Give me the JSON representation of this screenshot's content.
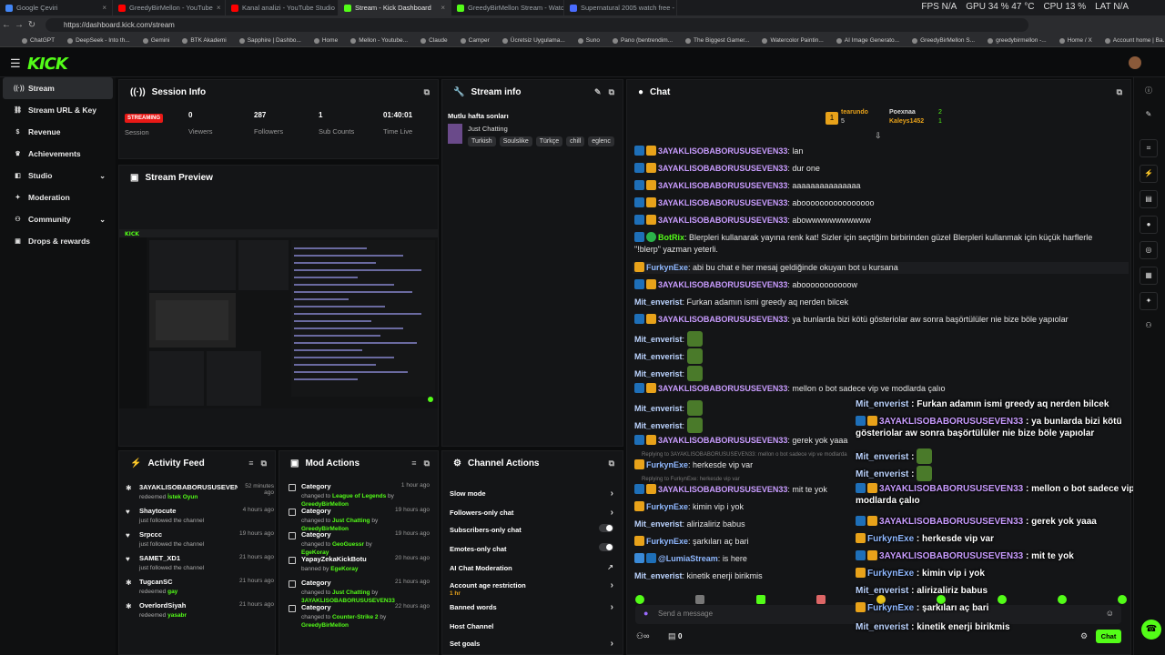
{
  "browser": {
    "tabs": [
      "Google Çeviri",
      "GreedyBirMellon - YouTube",
      "Kanal analizi - YouTube Studio",
      "Stream - Kick Dashboard",
      "GreedyBirMellon Stream - Watch",
      "Supernatural 2005 watch free - 1s"
    ],
    "url": "https://dashboard.kick.com/stream",
    "perf": [
      "FPS N/A",
      "GPU 34 % 47 °C",
      "CPU 13 %",
      "LAT N/A"
    ],
    "bookmarks": [
      "ChatGPT",
      "DeepSeek - Into th...",
      "Gemini",
      "BTK Akademi",
      "Sapphire | Dashbo...",
      "Home",
      "Mellon - Youtube...",
      "Claude",
      "Camper",
      "Ücretsiz Uygulama...",
      "Suno",
      "Pano (bentrendim...",
      "The Biggest Gamer...",
      "Watercolor Paintin...",
      "AI Image Generato...",
      "GreedyBirMellon S...",
      "greedybirmellon -...",
      "Home / X",
      "Account home | Ba..."
    ]
  },
  "app": {
    "logo": "KICK"
  },
  "sidebar": [
    {
      "label": "Stream",
      "icon": "broadcast-icon"
    },
    {
      "label": "Stream URL & Key",
      "icon": "link-icon"
    },
    {
      "label": "Revenue",
      "icon": "dollar-icon"
    },
    {
      "label": "Achievements",
      "icon": "trophy-icon"
    },
    {
      "label": "Studio",
      "icon": "studio-icon"
    },
    {
      "label": "Moderation",
      "icon": "wrench-icon"
    },
    {
      "label": "Community",
      "icon": "people-icon"
    },
    {
      "label": "Drops & rewards",
      "icon": "gift-icon"
    }
  ],
  "session": {
    "title": "Session Info",
    "status": "STREAMING",
    "session_label": "Session",
    "stats": [
      {
        "value": "0",
        "label": "Viewers"
      },
      {
        "value": "287",
        "label": "Followers"
      },
      {
        "value": "1",
        "label": "Sub Counts"
      },
      {
        "value": "01:40:01",
        "label": "Time Live"
      }
    ]
  },
  "preview": {
    "title": "Stream Preview"
  },
  "streaminfo": {
    "title": "Stream info",
    "stream_title": "Mutlu hafta sonları",
    "category": "Just Chatting",
    "tags": [
      "Turkish",
      "Soulslike",
      "Türkçe",
      "chill",
      "eglenc"
    ]
  },
  "chat": {
    "title": "Chat",
    "top": {
      "sub": "tearundo",
      "sub_count": "5",
      "leader1": "Poexnaa",
      "leader1_count": "2",
      "leader2": "Kaleys1452",
      "leader2_count": "1"
    },
    "messages": [
      {
        "user": "3AYAKLISOBABORUSUSEVEN33",
        "text": "lan",
        "color": "#c99cff"
      },
      {
        "user": "3AYAKLISOBABORUSUSEVEN33",
        "text": "dur one",
        "color": "#c99cff"
      },
      {
        "user": "3AYAKLISOBABORUSUSEVEN33",
        "text": "aaaaaaaaaaaaaaa",
        "color": "#c99cff"
      },
      {
        "user": "3AYAKLISOBABORUSUSEVEN33",
        "text": "aboooooooooooooooo",
        "color": "#c99cff"
      },
      {
        "user": "3AYAKLISOBABORUSUSEVEN33",
        "text": "abowwwwwwwwwww",
        "color": "#c99cff"
      },
      {
        "user": "BotRix",
        "text": "Blerpleri kullanarak yayına renk kat! Sizler için seçtiğim birbirinden güzel Blerpleri kullanmak için küçük harflerle \"!blerp\" yazman yeterli.",
        "color": "#53fc18"
      },
      {
        "user": "FurkynExe",
        "text": "abi bu chat e her mesaj geldiğinde okuyan bot u kursana",
        "color": "#8fb8ff"
      },
      {
        "user": "3AYAKLISOBABORUSUSEVEN33",
        "text": "abooooooooooow",
        "color": "#c99cff"
      },
      {
        "user": "Mit_enverist",
        "text": "Furkan adamın ismi greedy aq nerden bilcek",
        "color": "#bcd4ff"
      },
      {
        "user": "3AYAKLISOBABORUSUSEVEN33",
        "text": "ya bunlarda bizi kötü gösteriolar aw sonra başörtülüler nie bize böle yapıolar",
        "color": "#c99cff"
      },
      {
        "user": "Mit_enverist",
        "text": "",
        "color": "#bcd4ff"
      },
      {
        "user": "Mit_enverist",
        "text": "",
        "color": "#bcd4ff"
      },
      {
        "user": "Mit_enverist",
        "text": "",
        "color": "#bcd4ff"
      },
      {
        "user": "3AYAKLISOBABORUSUSEVEN33",
        "text": "mellon o bot sadece vip ve modlarda çalıo",
        "color": "#c99cff"
      },
      {
        "user": "Mit_enverist",
        "text": "",
        "color": "#bcd4ff"
      },
      {
        "user": "Mit_enverist",
        "text": "",
        "color": "#bcd4ff"
      },
      {
        "user": "3AYAKLISOBABORUSUSEVEN33",
        "text": "gerek yok yaaa",
        "color": "#c99cff"
      },
      {
        "user": "FurkynExe",
        "text": "herkesde vip var",
        "color": "#8fb8ff",
        "reply": "Replying to 3AYAKLISOBABORUSUSEVEN33: mellon o bot sadece vip ve modlarda"
      },
      {
        "user": "3AYAKLISOBABORUSUSEVEN33",
        "text": "mit te yok",
        "color": "#c99cff",
        "reply": "Replying to FurkynExe: herkesde vip var"
      },
      {
        "user": "FurkynExe",
        "text": "kimin vip i yok",
        "color": "#8fb8ff"
      },
      {
        "user": "Mit_enverist",
        "text": "alirizaliriz babus",
        "color": "#bcd4ff"
      },
      {
        "user": "FurkynExe",
        "text": "şarkıları aç bari",
        "color": "#8fb8ff"
      },
      {
        "user": "@LumiaStream",
        "text": "is here",
        "color": "#8fb8ff"
      },
      {
        "user": "Mit_enverist",
        "text": "kinetik enerji birikmis",
        "color": "#bcd4ff"
      }
    ],
    "overlay": [
      {
        "user": "Mit_enverist",
        "text": "Furkan adamın ismi greedy aq nerden bilcek"
      },
      {
        "user": "3AYAKLISOBABORUSUSEVEN33",
        "text": "ya bunlarda bizi kötü gösteriolar aw sonra başörtülüler nie bize böle yapıolar"
      },
      {
        "user": "Mit_enverist",
        "text": ""
      },
      {
        "user": "Mit_enverist",
        "text": ""
      },
      {
        "user": "3AYAKLISOBABORUSUSEVEN33",
        "text": "mellon o bot sadece vip ve modlarda çalıo"
      },
      {
        "user": "3AYAKLISOBABORUSUSEVEN33",
        "text": "gerek yok yaaa"
      },
      {
        "user": "FurkynExe",
        "text": "herkesde vip var"
      },
      {
        "user": "3AYAKLISOBABORUSUSEVEN33",
        "text": "mit te yok"
      },
      {
        "user": "FurkynExe",
        "text": "kimin vip i yok"
      },
      {
        "user": "Mit_enverist",
        "text": "alirizaliriz babus"
      },
      {
        "user": "FurkynExe",
        "text": "şarkıları aç bari"
      },
      {
        "user": "Mit_enverist",
        "text": "kinetik enerji birikmis"
      }
    ],
    "input_placeholder": "Send a message",
    "count": "0",
    "send_label": "Chat"
  },
  "activity": {
    "title": "Activity Feed",
    "items": [
      {
        "name": "3AYAKLISOBABORUSUSEVEN33",
        "action": "redeemed",
        "target": "İstek Oyun",
        "time": "52 minutes ago"
      },
      {
        "name": "Shaytocute",
        "action": "just followed the channel",
        "target": "",
        "time": "4 hours ago"
      },
      {
        "name": "Srpccc",
        "action": "just followed the channel",
        "target": "",
        "time": "19 hours ago"
      },
      {
        "name": "SAMET_XD1",
        "action": "just followed the channel",
        "target": "",
        "time": "21 hours ago"
      },
      {
        "name": "TugcanSC",
        "action": "redeemed",
        "target": "gay",
        "time": "21 hours ago"
      },
      {
        "name": "OverlordSiyah",
        "action": "redeemed",
        "target": "yasabr",
        "time": "21 hours ago"
      }
    ]
  },
  "mod": {
    "title": "Mod Actions",
    "items": [
      {
        "name": "Category",
        "line1": "changed to",
        "v1": "League of Legends",
        "line2": "by",
        "v2": "GreedyBirMellon",
        "time": "1 hour ago"
      },
      {
        "name": "Category",
        "line1": "changed to",
        "v1": "Just Chatting",
        "line2": "by",
        "v2": "GreedyBirMellon",
        "time": "19 hours ago"
      },
      {
        "name": "Category",
        "line1": "changed to",
        "v1": "GeoGuessr",
        "line2": "by",
        "v2": "EgeKoray",
        "time": "19 hours ago"
      },
      {
        "name": "YapayZekaKickBotu",
        "line1": "banned by",
        "v1": "EgeKoray",
        "line2": "",
        "v2": "",
        "time": "20 hours ago"
      },
      {
        "name": "Category",
        "line1": "changed to",
        "v1": "Just Chatting",
        "line2": "by",
        "v2": "3AYAKLISOBABORUSUSEVEN33",
        "time": "21 hours ago"
      },
      {
        "name": "Category",
        "line1": "changed to",
        "v1": "Counter-Strike 2",
        "line2": "by",
        "v2": "GreedyBirMellon",
        "time": "22 hours ago"
      }
    ]
  },
  "actions": {
    "title": "Channel Actions",
    "items": [
      {
        "label": "Slow mode",
        "kind": "arrow",
        "sub": ""
      },
      {
        "label": "Followers-only chat",
        "kind": "arrow",
        "sub": ""
      },
      {
        "label": "Subscribers-only chat",
        "kind": "toggle",
        "sub": ""
      },
      {
        "label": "Emotes-only chat",
        "kind": "toggle",
        "sub": ""
      },
      {
        "label": "AI Chat Moderation",
        "kind": "ext",
        "sub": ""
      },
      {
        "label": "Account age restriction",
        "kind": "arrow",
        "sub": "1 hr"
      },
      {
        "label": "Banned words",
        "kind": "arrow",
        "sub": ""
      },
      {
        "label": "Host Channel",
        "kind": "none",
        "sub": ""
      },
      {
        "label": "Set goals",
        "kind": "arrow",
        "sub": ""
      }
    ]
  },
  "colors": {
    "accent": "#53fc18",
    "live": "#e91916"
  }
}
